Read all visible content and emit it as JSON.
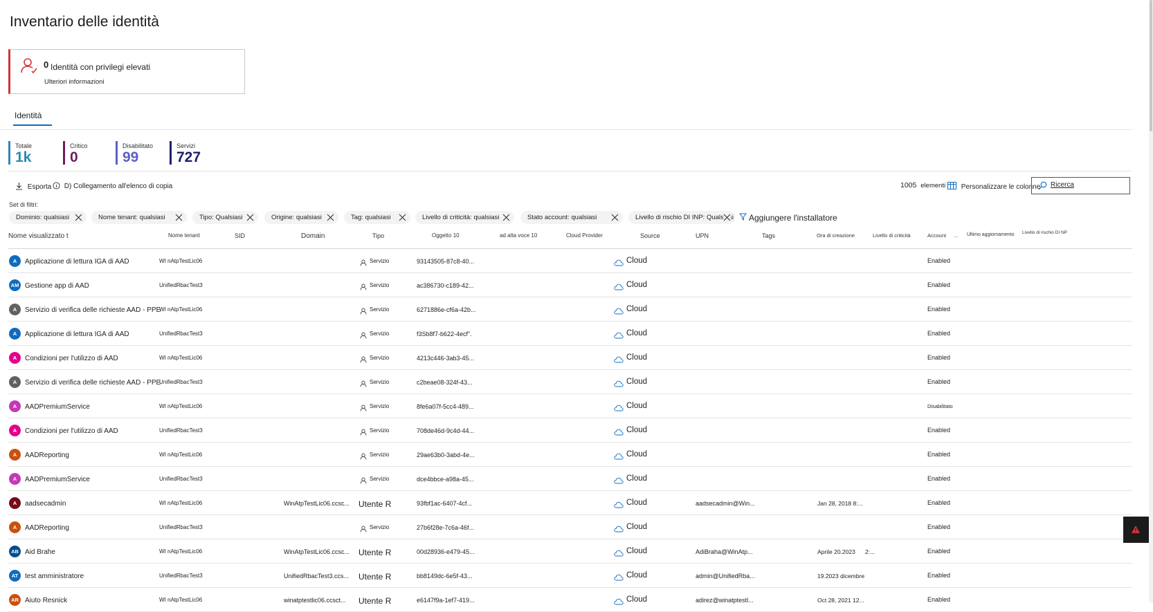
{
  "page": {
    "title": "Inventario delle identità"
  },
  "privileged_card": {
    "count": "0",
    "label": "Identità con privilegi elevati",
    "more_link": "Ulteriori informazioni",
    "icon": "user-warning-icon"
  },
  "tabs": [
    {
      "label": "Identità",
      "selected": true
    }
  ],
  "stats": [
    {
      "label": "Totale",
      "value": "1k",
      "color": "#2b88b8"
    },
    {
      "label": "Critico",
      "value": "0",
      "color": "#6b1d5f"
    },
    {
      "label": "Disabilitato",
      "value": "99",
      "color": "#5b5fc7"
    },
    {
      "label": "Servizi",
      "value": "727",
      "color": "#1b1f6b"
    }
  ],
  "toolbar": {
    "export_label": "Esporta",
    "copy_link_label": "D) Collegamento all'elenco di copia",
    "count": "1005",
    "count_suffix": "elementi",
    "customize_label": "Personalizzare le colonne",
    "search_placeholder": "Ricerca"
  },
  "filters": {
    "label": "Set di filtri:",
    "chips": [
      "Dominio: qualsiasi",
      "Nome tenant: qualsiasi",
      "Tipo: Qualsiasi",
      "Origine: qualsiasi",
      "Tag: qualsiasi",
      "Livello di criticità: qualsiasi",
      "Stato account: qualsiasi",
      "Livello di rischio DI INP: Qualsiasi"
    ],
    "add_label": "Aggiungere l'installatore"
  },
  "table": {
    "columns": [
      "Nome visualizzato t",
      "Nome tenant",
      "SID",
      "Domain",
      "Tipo",
      "Oggetto 10",
      "ad alta voce 10",
      "Cloud Provider",
      "Source",
      "UPN",
      "Tags",
      "Ora di creazione",
      "Livello di criticità",
      "Account",
      "...",
      "Ultimo aggiornamento",
      "Livello di rischio DI NP"
    ],
    "rows": [
      {
        "initials": "A",
        "avatar_color": "#0f6cbd",
        "name": "Applicazione di lettura IGA di AAD",
        "tenant": "WI nAtpTestLic06",
        "domain": "",
        "tipo": "Servizio",
        "tipo_is_user": false,
        "object_id": "93143505-87c8-40...",
        "source": "Cloud",
        "upn": "",
        "created": "",
        "account": "Enabled"
      },
      {
        "initials": "AM",
        "avatar_color": "#0f6cbd",
        "name": "Gestione app di AAD",
        "tenant": "UnifiedRbacTest3",
        "domain": "",
        "tipo": "Servizio",
        "tipo_is_user": false,
        "object_id": "ac386730-c189-42...",
        "source": "Cloud",
        "upn": "",
        "created": "",
        "account": "Enabled"
      },
      {
        "initials": "A",
        "avatar_color": "#616161",
        "name": "Servizio di verifica delle richieste AAD -   PPE",
        "tenant": "WI nAtpTestLic06",
        "domain": "",
        "tipo": "Servizio",
        "tipo_is_user": false,
        "object_id": "6271886e-cf6a-42b...",
        "source": "Cloud",
        "upn": "",
        "created": "",
        "account": "Enabled"
      },
      {
        "initials": "A",
        "avatar_color": "#0f6cbd",
        "name": "Applicazione di lettura IGA di AAD",
        "tenant": "UnifiedRbacTest3",
        "domain": "",
        "tipo": "Servizio",
        "tipo_is_user": false,
        "object_id": "f3Sb8f7-b622-4ecf\".",
        "source": "Cloud",
        "upn": "",
        "created": "",
        "account": "Enabled"
      },
      {
        "initials": "A",
        "avatar_color": "#e3008c",
        "name": "Condizioni per l'utilizzo di AAD",
        "tenant": "WI nAtpTestLic06",
        "domain": "",
        "tipo": "Servizio",
        "tipo_is_user": false,
        "object_id": "4213c446-3ab3-45...",
        "source": "Cloud",
        "upn": "",
        "created": "",
        "account": "Enabled"
      },
      {
        "initials": "A",
        "avatar_color": "#616161",
        "name": "Servizio di verifica delle richieste AAD -   PPE",
        "tenant": "UnifiedRbacTest3",
        "domain": "",
        "tipo": "Servizio",
        "tipo_is_user": false,
        "object_id": "c2beae08-324f-43...",
        "source": "Cloud",
        "upn": "",
        "created": "",
        "account": "Enabled"
      },
      {
        "initials": "A",
        "avatar_color": "#c239b3",
        "name": "AADPremiumService",
        "tenant": "WI nAtpTestLic06",
        "domain": "",
        "tipo": "Servizio",
        "tipo_is_user": false,
        "object_id": "8fe6a07f-5cc4-489...",
        "source": "Cloud",
        "upn": "",
        "created": "",
        "account": "Disabilitato"
      },
      {
        "initials": "A",
        "avatar_color": "#e3008c",
        "name": "Condizioni per l'utilizzo di AAD",
        "tenant": "UnifiedRbacTest3",
        "domain": "",
        "tipo": "Servizio",
        "tipo_is_user": false,
        "object_id": "708de46d-9c4d-44...",
        "source": "Cloud",
        "upn": "",
        "created": "",
        "account": "Enabled"
      },
      {
        "initials": "A",
        "avatar_color": "#ca5010",
        "name": "AADReporting",
        "tenant": "WI nAtpTestLic06",
        "domain": "",
        "tipo": "Servizio",
        "tipo_is_user": false,
        "object_id": "29ae63b0-3abd-4e...",
        "source": "Cloud",
        "upn": "",
        "created": "",
        "account": "Enabled"
      },
      {
        "initials": "A",
        "avatar_color": "#c239b3",
        "name": "AADPremiumService",
        "tenant": "UnifiedRbacTest3",
        "domain": "",
        "tipo": "Servizio",
        "tipo_is_user": false,
        "object_id": "dce4bbce-a98a-45...",
        "source": "Cloud",
        "upn": "",
        "created": "",
        "account": "Enabled"
      },
      {
        "initials": "A",
        "avatar_color": "#750b1c",
        "name": "aadsecadmin",
        "tenant": "WI nAtpTestLic06",
        "domain": "WinAtpTestLic06.ccsc...",
        "tipo": "Utente R",
        "tipo_is_user": true,
        "object_id": "93fbf1ac-6407-4cf...",
        "source": "Cloud",
        "upn": "aadsecadmin@Win...",
        "created": "Jan 28, 2018 8:...",
        "account": "Enabled"
      },
      {
        "initials": "A",
        "avatar_color": "#ca5010",
        "name": "AADReporting",
        "tenant": "UnifiedRbacTest3",
        "domain": "",
        "tipo": "Servizio",
        "tipo_is_user": false,
        "object_id": "27b6f28e-7c6a-46f...",
        "source": "Cloud",
        "upn": "",
        "created": "",
        "account": "Enabled"
      },
      {
        "initials": "AB",
        "avatar_color": "#004e8c",
        "name": "Aid Brahe",
        "tenant": "WI nAtpTestLic06",
        "domain": "WinAtpTestLic06.ccsc...",
        "tipo": "Utente R",
        "tipo_is_user": true,
        "object_id": "00d28936-e479-45...",
        "source": "Cloud",
        "upn": "AdiBraha@WinAtp...",
        "created": "Aprile 20.2023      2:...",
        "account": "Enabled"
      },
      {
        "initials": "AT",
        "avatar_color": "#0f6cbd",
        "name": "test amministratore",
        "tenant": "UnifiedRbacTest3",
        "domain": "UnifiedRbacTest3.ccs...",
        "tipo": "Utente R",
        "tipo_is_user": true,
        "object_id": "bb8149dc-6e5f-43...",
        "source": "Cloud",
        "upn": "admin@UnifiedRba...",
        "created": "19.2023 dicembre",
        "account": "Enabled"
      },
      {
        "initials": "AR",
        "avatar_color": "#ca5010",
        "name": "Aiuto Resnick",
        "tenant": "WI nAtpTestLic06",
        "domain": "winatptestlic06.ccsct...",
        "tipo": "Utente R",
        "tipo_is_user": true,
        "object_id": "e6147f9a-1ef7-419...",
        "source": "Cloud",
        "upn": "adirez@winatptestl...",
        "created": "Oct 28, 2021 12...",
        "account": "Enabled"
      }
    ]
  },
  "colors": {
    "accent": "#0f6cbd",
    "alert": "#d13438"
  }
}
